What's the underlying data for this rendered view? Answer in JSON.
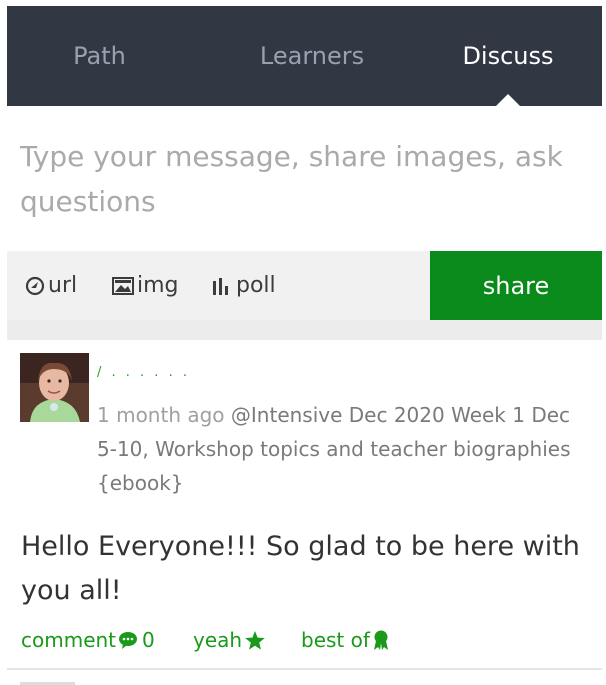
{
  "tabs": [
    {
      "label": "Path",
      "active": false
    },
    {
      "label": "Learners",
      "active": false
    },
    {
      "label": "Discuss",
      "active": true
    }
  ],
  "composer": {
    "placeholder": "Type your message, share images, ask questions"
  },
  "toolbar": {
    "url_label": "url",
    "url_icon": "link-globe-icon",
    "img_label": "img",
    "img_icon": "image-icon",
    "poll_label": "poll",
    "poll_icon": "poll-bars-icon",
    "share_label": "share"
  },
  "post": {
    "author_name": "/ . . . . . . ",
    "time": "1 month ago",
    "context": "@Intensive Dec 2020 Week 1 Dec 5-10, Workshop topics and teacher biographies {ebook}",
    "body": "Hello Everyone!!! So glad to be here with you all!",
    "actions": {
      "comment_label": "comment",
      "comment_icon": "speech-bubble-icon",
      "comment_count": "0",
      "yeah_label": "yeah",
      "yeah_icon": "star-icon",
      "bestof_label": "best of",
      "bestof_icon": "award-ribbon-icon"
    }
  },
  "colors": {
    "header_bg": "#323744",
    "accent_green": "#0a8a1a",
    "link_green": "#1a9a1a",
    "toolbar_bg": "#f1f1f1"
  }
}
